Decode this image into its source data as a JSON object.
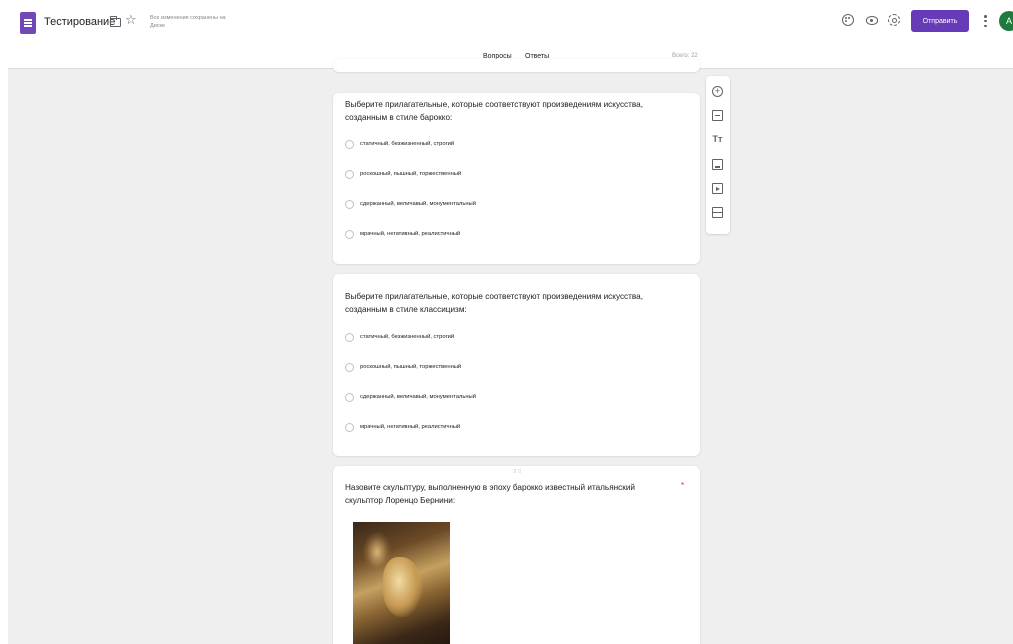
{
  "header": {
    "title": "Тестирование",
    "save_status": "Все изменения сохранены на Диске",
    "send_label": "Отправить",
    "avatar_letter": "A"
  },
  "tabs": {
    "questions": "Вопросы",
    "answers": "Ответы",
    "total": "Всего: 22"
  },
  "icons": [
    "app-forms-icon",
    "folder-icon",
    "star-icon",
    "palette-icon",
    "preview-eye-icon",
    "settings-icon",
    "more-vert-icon",
    "add-question-icon",
    "import-questions-icon",
    "add-title-icon",
    "add-image-icon",
    "add-video-icon",
    "add-section-icon",
    "drag-handle-icon"
  ],
  "colors": {
    "accent": "#673ab7",
    "background": "#efeff0",
    "required": "#d93025"
  },
  "questions": [
    {
      "text": "Выберите прилагательные, которые соответствуют произведениям искусства, созданным в стиле барокко:",
      "options": [
        "статичный, безжизненный, строгий",
        "роскошный, пышный, торжественный",
        "сдержанный, величавый, монументальный",
        "мрачный, негативный, реалистичный"
      ]
    },
    {
      "text": "Выберите прилагательные, которые соответствуют произведениям искусства, созданным в стиле классицизм:",
      "options": [
        "статичный, безжизненный, строгий",
        "роскошный, пышный, торжественный",
        "сдержанный, величавый, монументальный",
        "мрачный, негативный, реалистичный"
      ]
    },
    {
      "text": "Назовите скульптуру, выполненную в эпоху барокко известный итальянский скульптор Лоренцо Бернини:",
      "required_mark": "*"
    }
  ]
}
